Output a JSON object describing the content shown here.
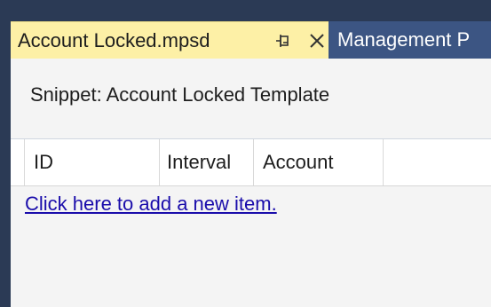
{
  "tabs": {
    "active": {
      "title": "Account Locked.mpsd",
      "pin_icon": "pin-icon",
      "close_icon": "close-icon"
    },
    "inactive": {
      "title": "Management P"
    }
  },
  "document": {
    "snippet_title": "Snippet: Account Locked Template",
    "grid": {
      "columns": [
        "ID",
        "Interval",
        "Account"
      ],
      "rows": [],
      "add_item_link": "Click here to add a new item."
    }
  },
  "colors": {
    "active_tab": "#fdf0a6",
    "inactive_tab": "#3c5583",
    "frame": "#2b3a55",
    "link": "#1a0dab"
  }
}
